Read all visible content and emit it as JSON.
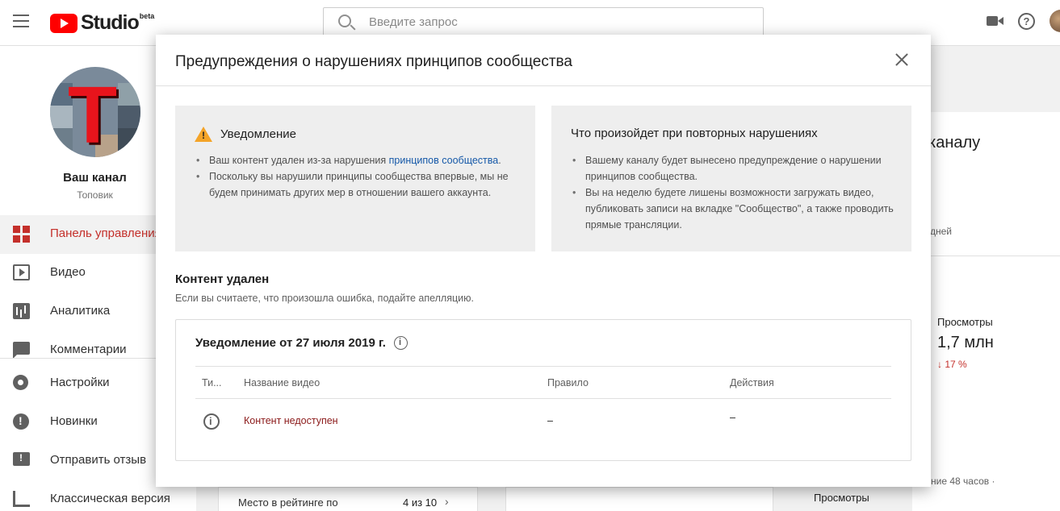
{
  "topbar": {
    "logo_text": "Studio",
    "logo_badge": "beta",
    "search_placeholder": "Введите запрос",
    "help_symbol": "?"
  },
  "sidebar": {
    "channel_name": "Ваш канал",
    "channel_subtitle": "Топовик",
    "items": [
      {
        "label": "Панель управления",
        "icon": "dashboard-icon",
        "active": true
      },
      {
        "label": "Видео",
        "icon": "video-icon"
      },
      {
        "label": "Аналитика",
        "icon": "analytics-icon"
      },
      {
        "label": "Комментарии",
        "icon": "comments-icon"
      },
      {
        "label": "Настройки",
        "icon": "settings-icon"
      },
      {
        "label": "Новинки",
        "icon": "whats-new-icon"
      },
      {
        "label": "Отправить отзыв",
        "icon": "feedback-icon"
      },
      {
        "label": "Классическая версия",
        "icon": "classic-icon"
      }
    ]
  },
  "background": {
    "partial_title": "каналу",
    "partial_days": "дней",
    "views_label": "Просмотры",
    "views_value": "1,7 млн",
    "views_delta": "↓ 17 %",
    "partial_hours": "ние 48 часов ·",
    "views_label_2": "Просмотры",
    "ranking_label": "Место в рейтинге по",
    "ranking_value": "4 из 10"
  },
  "dialog": {
    "title": "Предупреждения о нарушениях принципов сообщества",
    "notice_box": {
      "heading": "Уведомление",
      "bullet1_prefix": "Ваш контент удален из-за нарушения ",
      "bullet1_link": "принципов сообщества",
      "bullet1_suffix": ".",
      "bullet2": "Поскольку вы нарушили принципы сообщества впервые, мы не будем принимать других мер в отношении вашего аккаунта."
    },
    "repeat_box": {
      "heading": "Что произойдет при повторных нарушениях",
      "bullets": [
        "Вашему каналу будет вынесено предупреждение о нарушении принципов сообщества.",
        "Вы на неделю будете лишены возможности загружать видео, публиковать записи на вкладке \"Сообщество\", а также проводить прямые трансляции."
      ]
    },
    "removed_title": "Контент удален",
    "removed_subtitle": "Если вы считаете, что произошла ошибка, подайте апелляцию.",
    "notice_card": {
      "title": "Уведомление от 27 июля 2019 г.",
      "columns": [
        "Ти...",
        "Название видео",
        "Правило",
        "Действия"
      ],
      "rows": [
        {
          "video_title": "Контент недоступен",
          "rule": "–",
          "actions": "–"
        }
      ]
    }
  },
  "colors": {
    "brand_red": "#ff0000",
    "active_nav": "#c4302b",
    "link": "#1558a8",
    "warning": "#f4a428"
  }
}
